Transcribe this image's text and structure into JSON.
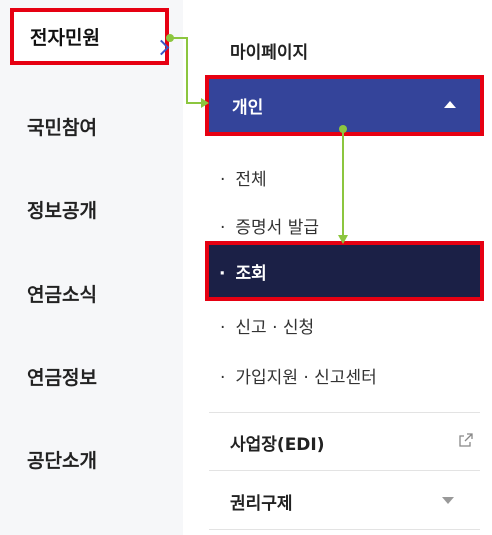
{
  "left_menu": {
    "active_label": "전자민원",
    "items": [
      "국민참여",
      "정보공개",
      "연금소식",
      "연금정보",
      "공단소개"
    ]
  },
  "sub_menu": {
    "mypage": "마이페이지",
    "gaein": "개인",
    "items": [
      "전체",
      "증명서 발급",
      "조회",
      "신고 · 신청",
      "가입지원 · 신고센터"
    ],
    "bullet": "·",
    "edi": "사업장(EDI)",
    "rights": "권리구제"
  },
  "colors": {
    "highlight": "#e60012",
    "selected_bg": "#34449a",
    "active_item_bg": "#1b2046",
    "connector": "#8cc63f"
  }
}
